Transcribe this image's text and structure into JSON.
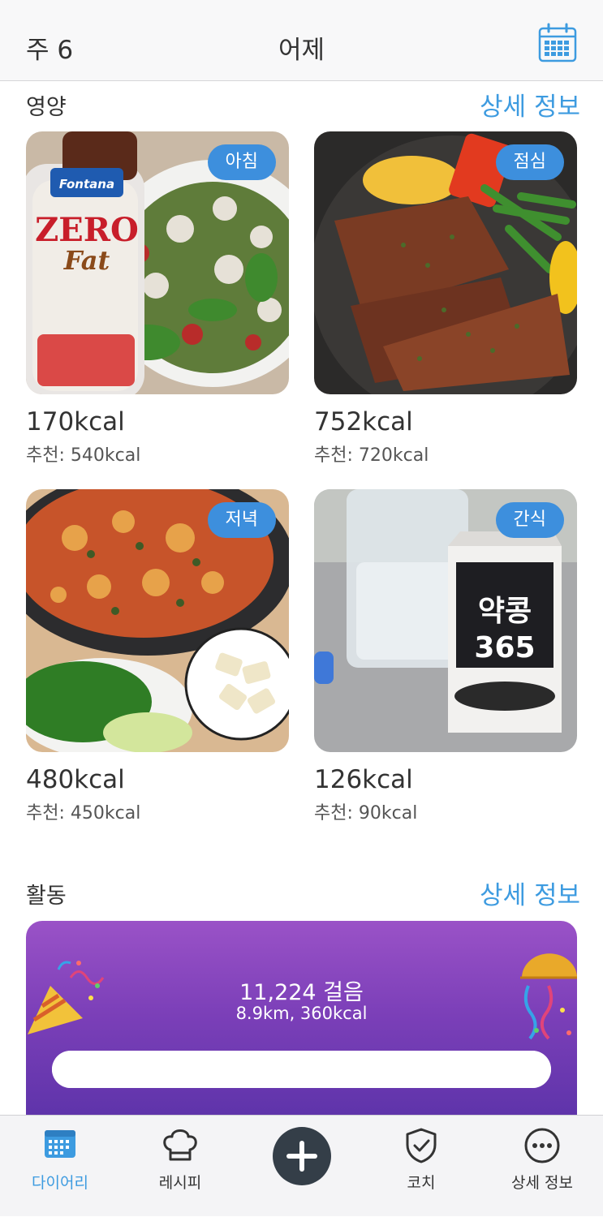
{
  "header": {
    "week_label": "주 6",
    "day_label": "어제",
    "calendar_icon": "calendar-icon"
  },
  "nutrition": {
    "title": "영양",
    "link": "상세 정보",
    "meals": [
      {
        "badge": "아침",
        "kcal": "170kcal",
        "recommended": "추천: 540kcal",
        "photo": "breakfast-salad-photo"
      },
      {
        "badge": "점심",
        "kcal": "752kcal",
        "recommended": "추천: 720kcal",
        "photo": "lunch-steak-photo"
      },
      {
        "badge": "저녁",
        "kcal": "480kcal",
        "recommended": "추천: 450kcal",
        "photo": "dinner-stirfry-photo"
      },
      {
        "badge": "간식",
        "kcal": "126kcal",
        "recommended": "추천: 90kcal",
        "photo": "snack-soymilk-photo"
      }
    ],
    "photo_text": {
      "bottle_brand": "Fontana",
      "bottle_name_top": "ZERO",
      "bottle_name_bottom": "Fat",
      "carton_line1": "약콩",
      "carton_line2": "365"
    }
  },
  "activity": {
    "title": "활동",
    "link": "상세 정보",
    "steps": "11,224 걸음",
    "details": "8.9km, 360kcal",
    "progress": 1.0,
    "gradient_top": "#9a52c7",
    "gradient_bottom": "#5a32a8"
  },
  "tabbar": {
    "items": [
      {
        "label": "다이어리",
        "icon": "calendar-grid-icon",
        "active": true
      },
      {
        "label": "레시피",
        "icon": "chef-hat-icon",
        "active": false
      },
      {
        "label": "",
        "icon": "plus-icon",
        "active": false
      },
      {
        "label": "코치",
        "icon": "shield-check-icon",
        "active": false
      },
      {
        "label": "상세 정보",
        "icon": "more-dots-icon",
        "active": false
      }
    ]
  },
  "colors": {
    "accent": "#3d9be0",
    "badge": "#3d8fdd",
    "plus_button": "#343e48"
  }
}
